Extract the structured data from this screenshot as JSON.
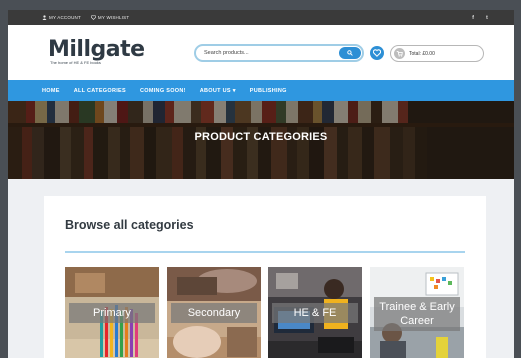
{
  "topbar": {
    "my_account": "MY ACCOUNT",
    "my_wishlist": "MY WISHLIST",
    "social": [
      "f",
      "t"
    ]
  },
  "header": {
    "logo_text": "Millgate",
    "logo_tagline": "The home of HE & FE books",
    "search_placeholder": "Search products...",
    "cart_label": "Total: £0.00",
    "icons": [
      "search-icon",
      "heart-icon",
      "cart-icon"
    ]
  },
  "nav": {
    "items": [
      "HOME",
      "ALL CATEGORIES",
      "COMING SOON!",
      "ABOUT US ▾",
      "PUBLISHING"
    ]
  },
  "hero": {
    "title": "PRODUCT CATEGORIES"
  },
  "main": {
    "heading": "Browse all categories",
    "categories": [
      "Primary",
      "Secondary",
      "HE & FE",
      "Trainee & Early Career"
    ]
  },
  "colors": {
    "accent": "#2f97e0",
    "topbar": "#3a3a3a",
    "heading": "#333b42"
  }
}
